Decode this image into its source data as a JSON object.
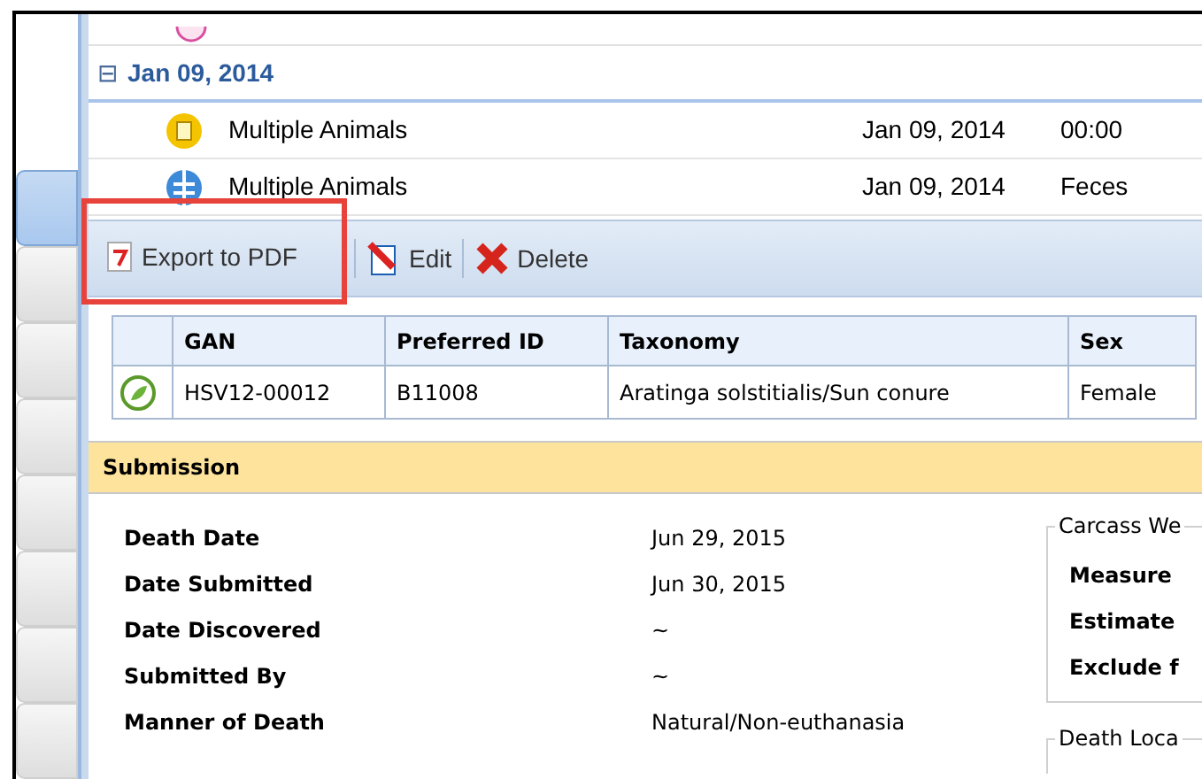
{
  "sidebar": {
    "tabs": [
      {
        "selected": true
      },
      {
        "selected": false
      },
      {
        "selected": false
      },
      {
        "selected": false
      },
      {
        "selected": false
      },
      {
        "selected": false
      },
      {
        "selected": false
      },
      {
        "selected": false
      }
    ]
  },
  "event_list": {
    "groups": [
      {
        "label": "Jan 09, 2014",
        "expanded": true,
        "expander": "⊟",
        "rows": [
          {
            "kind": "bin",
            "name": "Multiple Animals",
            "date": "Jan 09, 2014",
            "column_4": "00:00"
          },
          {
            "kind": "globe",
            "name": "Multiple Animals",
            "date": "Jan 09, 2014",
            "column_4": "Feces"
          }
        ]
      }
    ]
  },
  "toolbar": {
    "buttons": [
      {
        "kind": "pdf",
        "label": "Export to PDF",
        "highlighted": true
      },
      {
        "kind": "edit",
        "label": "Edit",
        "highlighted": false
      },
      {
        "kind": "delete",
        "label": "Delete",
        "highlighted": false
      }
    ]
  },
  "animal_table": {
    "columns": [
      "",
      "GAN",
      "Preferred ID",
      "Taxonomy",
      "Sex"
    ],
    "rows": [
      [
        "",
        "HSV12-00012",
        "B11008",
        "Aratinga solstitialis/Sun conure",
        "Female"
      ]
    ]
  },
  "submission": {
    "title": "Submission",
    "fields": [
      {
        "label": "Death Date",
        "value": "Jun 29, 2015"
      },
      {
        "label": "Date Submitted",
        "value": "Jun 30, 2015"
      },
      {
        "label": "Date Discovered",
        "value": "~"
      },
      {
        "label": "Submitted By",
        "value": "~"
      },
      {
        "label": "Manner of Death",
        "value": "Natural/Non-euthanasia"
      }
    ],
    "carcass": {
      "legend": "Carcass We",
      "labels": [
        "Measure",
        "Estimate",
        "Exclude f"
      ]
    },
    "death_location": {
      "legend": "Death Loca"
    }
  }
}
